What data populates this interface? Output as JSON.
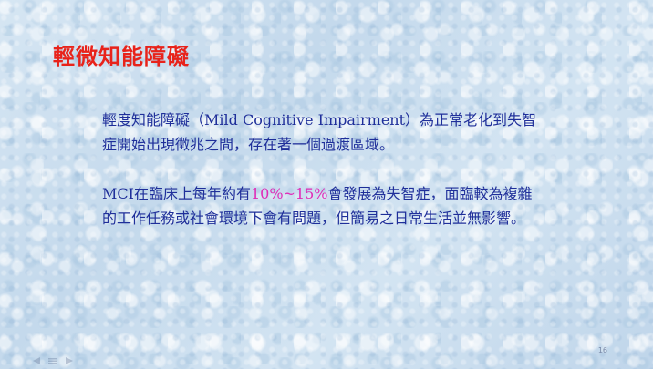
{
  "slide": {
    "title": "輕微知能障礙",
    "paragraph1": "輕度知能障礙（Mild Cognitive Impairment）為正常老化到失智症開始出現徵兆之間，存在著一個過渡區域。",
    "paragraph2": {
      "before": "MCI在臨床上每年約有",
      "highlight": "10%~15%",
      "after": "會發展為失智症，面臨較為複雜的工作任務或社會環境下會有問題，但簡易之日常生活並無影響。"
    },
    "page_number": "16"
  },
  "colors": {
    "title": "#e8231b",
    "body_text": "#1f2f9a",
    "highlight": "#e02bb7",
    "background": "#cfe0ef"
  },
  "icons": {
    "nav_previous": "triangle-left-icon",
    "nav_menu": "menu-icon",
    "nav_next": "triangle-right-icon"
  }
}
